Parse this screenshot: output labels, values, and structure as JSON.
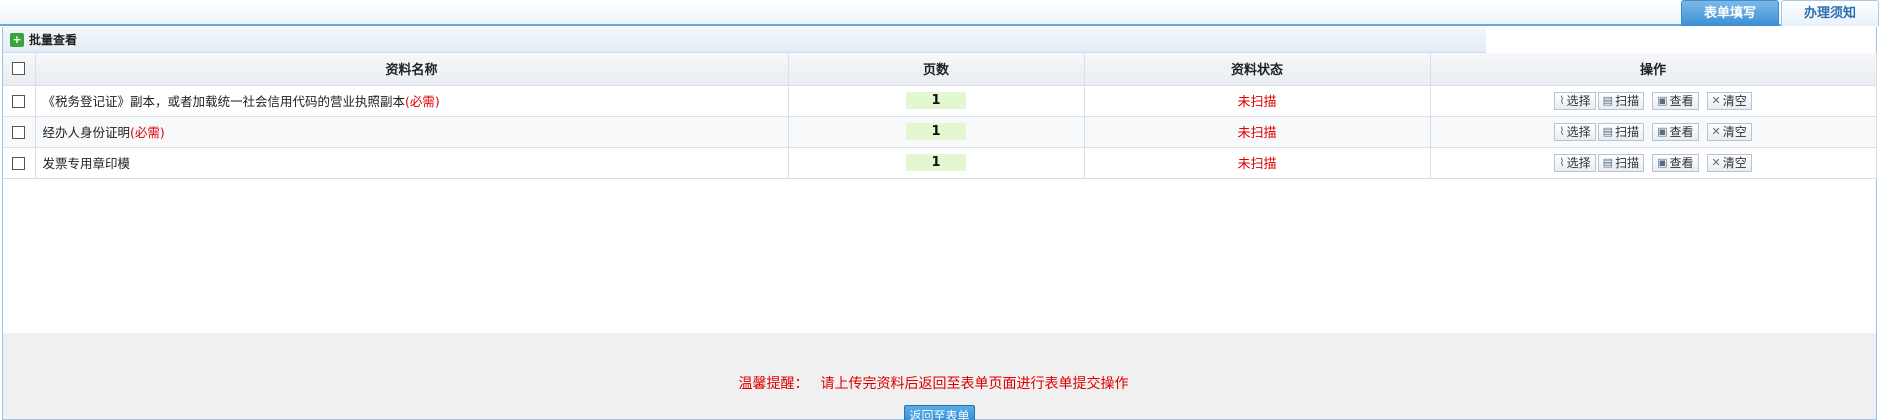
{
  "tabs": [
    {
      "label": "表单填写",
      "active": true
    },
    {
      "label": "办理须知",
      "active": false
    }
  ],
  "panel": {
    "title": "批量查看",
    "icon": "add-square-icon"
  },
  "table": {
    "headers": {
      "name": "资料名称",
      "pages": "页数",
      "status": "资料状态",
      "ops": "操作"
    },
    "rows": [
      {
        "name": "《税务登记证》副本，或者加载统一社会信用代码的营业执照副本",
        "required": "(必需)",
        "pages": "1",
        "status": "未扫描"
      },
      {
        "name": "经办人身份证明",
        "required": "(必需)",
        "pages": "1",
        "status": "未扫描"
      },
      {
        "name": "发票专用章印模",
        "required": "",
        "pages": "1",
        "status": "未扫描"
      }
    ],
    "ops": {
      "select": "选择",
      "scan": "扫描",
      "view": "查看",
      "clear": "清空"
    }
  },
  "footer": {
    "notice_label": "温馨提醒：",
    "notice_text": "请上传完资料后返回至表单页面进行表单提交操作",
    "back_button": "返回至表单"
  },
  "colors": {
    "accent": "#3c8ed3",
    "required": "#e00000",
    "page_box": "#e3f8d0"
  }
}
